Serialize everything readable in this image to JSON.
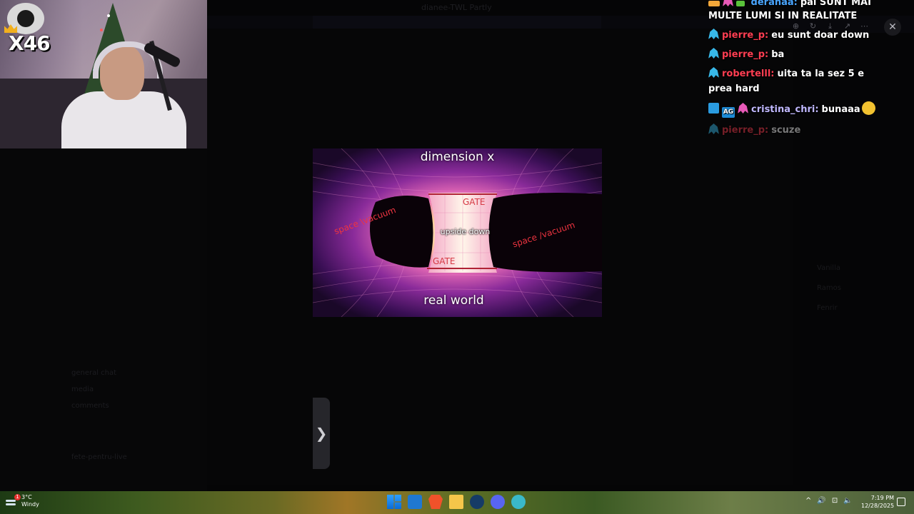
{
  "background_app": {
    "title": "dianee-TWL Partly",
    "channels": [
      "general chat",
      "media",
      "comments",
      "fete-pentru-live"
    ],
    "right_members": [
      "Vanilla",
      "Ramos",
      "Fenrir"
    ]
  },
  "webcam": {
    "multiplier": "X46"
  },
  "viewer": {
    "toolbar_icons": [
      "zoom-icon",
      "rotate-icon",
      "download-icon",
      "external-link-icon",
      "more-icon"
    ],
    "close_glyph": "✕",
    "next_glyph": "❯",
    "image": {
      "top_label": "dimension x",
      "bottom_label": "real world",
      "center_label": "upside down",
      "gate_top": "GATE",
      "gate_bottom": "GATE",
      "left_label": "space \\vacuum",
      "right_label": "space /vacuum"
    }
  },
  "chat": {
    "messages": [
      {
        "user": "deranaa:",
        "text": "pai SUNT MAI",
        "color": "#49a5ff"
      },
      {
        "user": "",
        "text": "MULTE LUMI SI IN REALITATE",
        "color": "#ffffff"
      },
      {
        "user": "pierre_p:",
        "text": "eu sunt doar down",
        "color": "#ff3e52"
      },
      {
        "user": "pierre_p:",
        "text": "ba",
        "color": "#ff3e52"
      },
      {
        "user": "robertelll:",
        "text": "uita ta la sez 5 e",
        "color": "#ff3e52"
      },
      {
        "user": "",
        "text": "prea hard",
        "color": "#ffffff"
      },
      {
        "user": "cristina_chri:",
        "text": "bunaaa",
        "color": "#c0b8ff"
      },
      {
        "user": "pierre_p:",
        "text": "scuze",
        "color": "#ff3e52"
      }
    ],
    "badge_ag": "AG"
  },
  "taskbar": {
    "temperature": "3°C",
    "condition": "Windy",
    "weather_alert": "1",
    "time": "7:19 PM",
    "date": "12/28/2025",
    "tray_glyphs": [
      "^",
      "🔊",
      "⊡",
      "🔈"
    ]
  }
}
